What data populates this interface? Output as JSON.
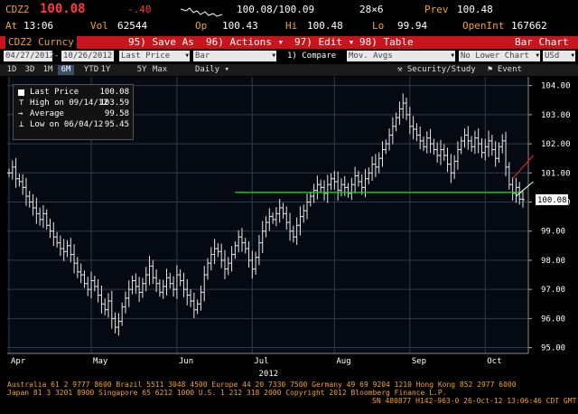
{
  "header": {
    "ticker": "CDZ2",
    "last": "100.08",
    "change": "-.40",
    "bid_ask": "100.08/100.09",
    "size": "28×6",
    "prev_label": "Prev",
    "prev_value": "100.48",
    "at_label": "At",
    "at_time": "13:06",
    "vol_label": "Vol",
    "vol_value": "62544",
    "op_label": "Op",
    "op_value": "100.43",
    "hi_label": "Hi",
    "hi_value": "100.48",
    "lo_label": "Lo",
    "lo_value": "99.94",
    "oi_label": "OpenInt",
    "oi_value": "167662"
  },
  "menubar": {
    "security": "CDZ2 Curncy",
    "save": "95) Save As",
    "actions": "96) Actions ▾",
    "edit": "97) Edit ▾",
    "table": "98) Table",
    "title": "Bar Chart"
  },
  "toolbar": {
    "start_date": "04/27/2012",
    "end_date": "10/26/2012",
    "price_field": "Last Price",
    "chart_type": "Bar",
    "compare": "1) Compare",
    "mov_avgs": "Mov. Avgs",
    "lower_chart": "No Lower Chart",
    "currency": "USd"
  },
  "ranges": {
    "items": [
      "1D",
      "3D",
      "1M",
      "6M",
      "YTD",
      "1Y",
      "5Y",
      "Max"
    ],
    "active": "6M",
    "interval": "Daily",
    "security_study": "Security/Study",
    "event": "Event"
  },
  "legend": {
    "last_label": "Last Price",
    "last_value": "100.08",
    "high_label": "High on 09/14/12",
    "high_value": "103.59",
    "avg_label": "Average",
    "avg_value": "99.58",
    "low_label": "Low on 06/04/12",
    "low_value": "95.45"
  },
  "chart_data": {
    "type": "bar",
    "title": "",
    "xlabel": "2012",
    "ylabel": "",
    "ylim": [
      94.8,
      104.3
    ],
    "y_ticks": [
      "104.00",
      "103.00",
      "102.00",
      "101.00",
      "100.00",
      "99.00",
      "98.00",
      "97.00",
      "96.00",
      "95.00"
    ],
    "y_tick_values": [
      104,
      103,
      102,
      101,
      100,
      99,
      98,
      97,
      96,
      95
    ],
    "x_ticks": [
      "Apr",
      "May",
      "Jun",
      "Jul",
      "Aug",
      "Sep",
      "Oct"
    ],
    "x_tick_index": [
      0,
      24,
      49,
      71,
      95,
      117,
      139
    ],
    "last_tag": "100.08",
    "support_level": 100.33,
    "support_start_index": 66,
    "support_end_index": 150,
    "closes": [
      101.0,
      101.2,
      100.8,
      100.7,
      100.5,
      100.2,
      100.0,
      99.8,
      99.6,
      99.4,
      99.6,
      99.2,
      99.0,
      98.8,
      98.6,
      98.4,
      98.3,
      98.5,
      98.2,
      97.9,
      97.6,
      97.5,
      97.2,
      97.0,
      97.3,
      97.1,
      96.8,
      96.5,
      96.3,
      96.6,
      96.0,
      95.7,
      95.9,
      96.4,
      96.7,
      97.0,
      97.3,
      97.1,
      96.9,
      97.2,
      97.5,
      97.8,
      97.4,
      97.2,
      96.9,
      97.1,
      97.4,
      97.2,
      97.0,
      97.5,
      97.3,
      97.0,
      96.8,
      96.6,
      96.3,
      96.5,
      96.9,
      97.5,
      97.9,
      98.2,
      98.4,
      98.3,
      98.0,
      97.7,
      97.9,
      98.2,
      98.5,
      98.8,
      98.6,
      98.4,
      98.0,
      97.7,
      98.1,
      98.6,
      99.0,
      99.3,
      99.5,
      99.4,
      99.6,
      99.8,
      99.6,
      99.3,
      99.0,
      98.8,
      99.2,
      99.5,
      99.7,
      100.0,
      100.2,
      100.4,
      100.6,
      100.5,
      100.3,
      100.6,
      100.8,
      100.7,
      100.4,
      100.6,
      100.5,
      100.3,
      100.6,
      100.9,
      100.7,
      100.5,
      100.8,
      101.0,
      101.3,
      101.2,
      101.5,
      101.8,
      102.0,
      102.3,
      102.6,
      102.9,
      103.2,
      103.4,
      103.0,
      102.6,
      102.5,
      102.3,
      102.1,
      101.9,
      102.2,
      102.0,
      101.8,
      101.6,
      101.8,
      101.6,
      101.3,
      101.0,
      101.4,
      101.8,
      102.1,
      102.3,
      102.1,
      101.9,
      102.2,
      102.0,
      101.7,
      101.9,
      102.1,
      101.8,
      101.5,
      101.9,
      102.1,
      101.2,
      100.6,
      100.3,
      100.5,
      100.1,
      100.08
    ],
    "trend_red": [
      [
        147,
        100.8
      ],
      [
        153,
        101.6
      ]
    ],
    "trend_white": [
      [
        148,
        100.2
      ],
      [
        153,
        100.7
      ]
    ]
  },
  "footer": {
    "line1": "Australia 61 2 9777 8600 Brazil 5511 3048 4500 Europe 44 20 7330 7500 Germany 49 69 9204 1210 Hong Kong 852 2977 6000",
    "line2a": "Japan 81 3 3201 8900         Singapore 65 6212 1000         U.S. 1 212 318 2000         Copyright 2012 Bloomberg Finance L.P.",
    "line2b": "SN 480877 H142-963-0 26-Oct-12 13:06:46 CDT  GMT-5:00"
  },
  "colors": {
    "menubar": "#c8141b",
    "header_orange": "#f0a030",
    "support_line": "#20c020",
    "trend_red": "#e02020",
    "grid": "#2e3a4c"
  }
}
